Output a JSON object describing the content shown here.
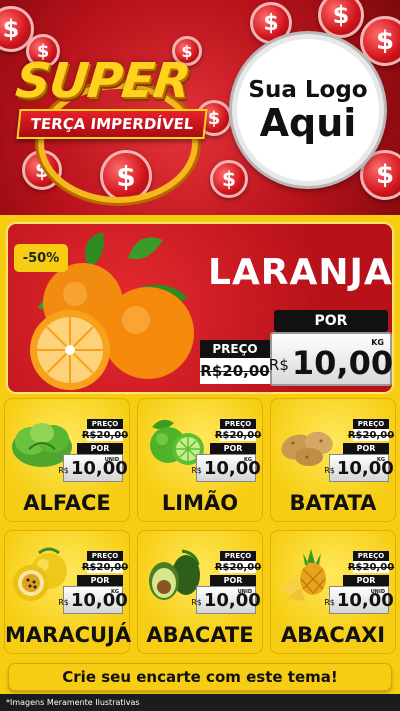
{
  "header": {
    "badge_title": "SUPER",
    "badge_subtitle": "TERÇA IMPERDÍVEL",
    "logo_line1": "Sua Logo",
    "logo_line2": "Aqui",
    "coin_symbol": "$"
  },
  "hero": {
    "discount": "-50%",
    "product": "LARANJA",
    "old_label": "PREÇO",
    "old_price": "R$20,00",
    "new_label": "POR",
    "currency": "R$",
    "new_price": "10,00",
    "unit": "KG"
  },
  "products": [
    {
      "name": "ALFACE",
      "icon": "lettuce-icon",
      "old_label": "PREÇO",
      "old_price": "R$20,00",
      "new_label": "POR",
      "currency": "R$",
      "new_price": "10,00",
      "unit": "UNID"
    },
    {
      "name": "LIMÃO",
      "icon": "lime-icon",
      "old_label": "PREÇO",
      "old_price": "R$20,00",
      "new_label": "POR",
      "currency": "R$",
      "new_price": "10,00",
      "unit": "KG"
    },
    {
      "name": "BATATA",
      "icon": "potato-icon",
      "old_label": "PREÇO",
      "old_price": "R$20,00",
      "new_label": "POR",
      "currency": "R$",
      "new_price": "10,00",
      "unit": "KG"
    },
    {
      "name": "MARACUJÁ",
      "icon": "passion-fruit-icon",
      "old_label": "PREÇO",
      "old_price": "R$20,00",
      "new_label": "POR",
      "currency": "R$",
      "new_price": "10,00",
      "unit": "KG"
    },
    {
      "name": "ABACATE",
      "icon": "avocado-icon",
      "old_label": "PREÇO",
      "old_price": "R$20,00",
      "new_label": "POR",
      "currency": "R$",
      "new_price": "10,00",
      "unit": "UNID"
    },
    {
      "name": "ABACAXI",
      "icon": "pineapple-icon",
      "old_label": "PREÇO",
      "old_price": "R$20,00",
      "new_label": "POR",
      "currency": "R$",
      "new_price": "10,00",
      "unit": "UNID"
    }
  ],
  "cta": "Crie seu encarte com este tema!",
  "footer": "*Imagens Meramente Ilustrativas",
  "colors": {
    "red": "#b8111a",
    "yellow": "#f6cd12",
    "gold": "#ffd21e",
    "black": "#111111"
  }
}
